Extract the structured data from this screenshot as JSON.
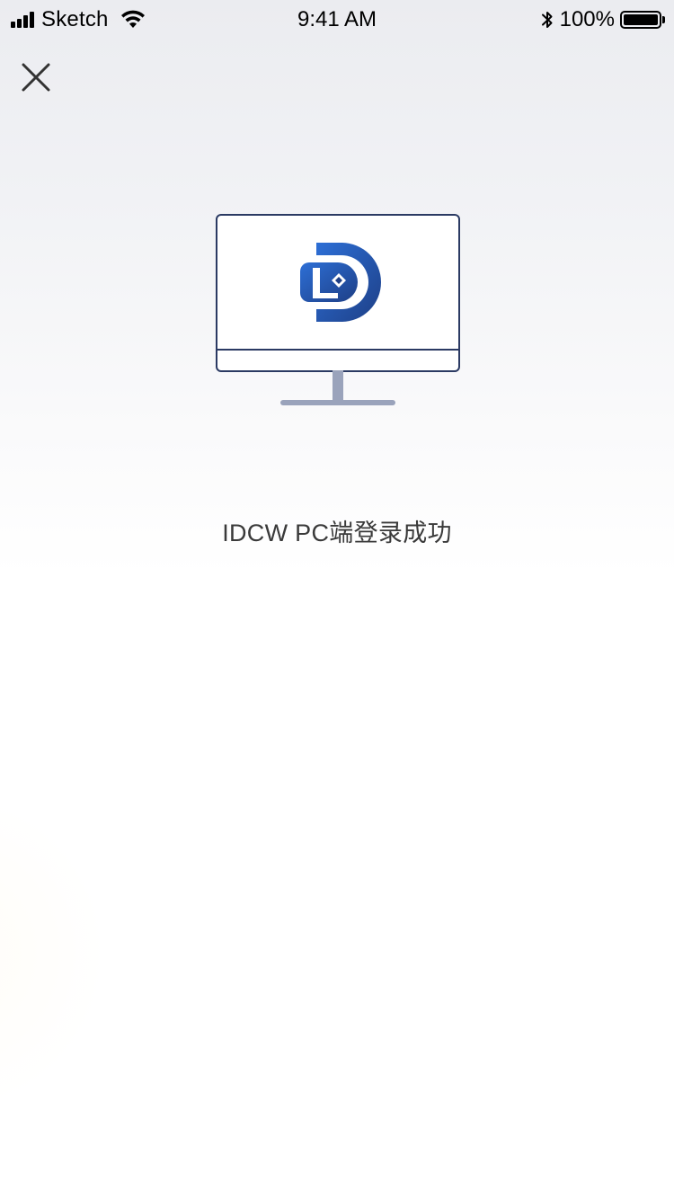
{
  "status_bar": {
    "carrier": "Sketch",
    "time": "9:41 AM",
    "battery_percent": "100%",
    "battery_level": 1.0,
    "icons": [
      "signal-icon",
      "wifi-icon",
      "bluetooth-icon",
      "battery-icon"
    ]
  },
  "nav": {
    "close_icon": "close-icon"
  },
  "illustration": {
    "icon": "desktop-monitor-icon",
    "logo": "idcw-logo",
    "colors": {
      "outline": "#2b3a63",
      "stand": "#9aa3bb",
      "logo_light": "#2d6fd6",
      "logo_dark": "#1e3f86"
    }
  },
  "message": {
    "text": "IDCW PC端登录成功"
  }
}
